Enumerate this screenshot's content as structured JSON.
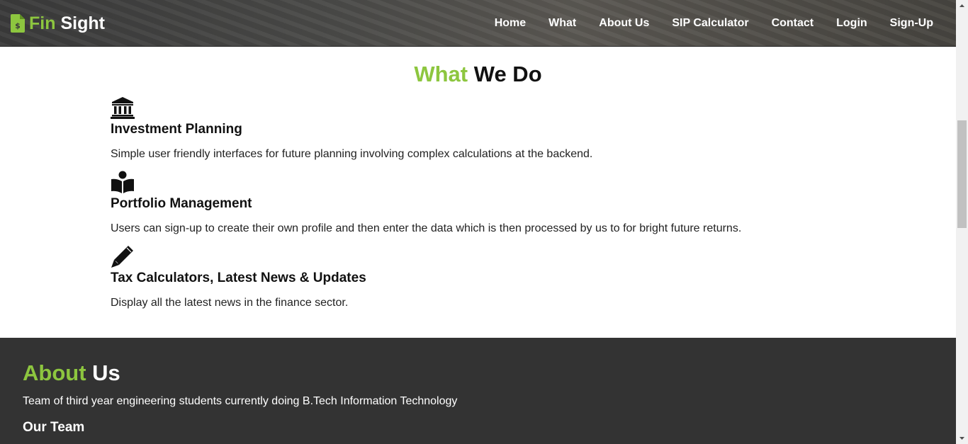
{
  "brand": {
    "part1": "Fin",
    "part2": "Sight",
    "icon": "document-dollar-icon"
  },
  "nav": {
    "items": [
      {
        "label": "Home"
      },
      {
        "label": "What"
      },
      {
        "label": "About Us"
      },
      {
        "label": "SIP Calculator"
      },
      {
        "label": "Contact"
      },
      {
        "label": "Login"
      },
      {
        "label": "Sign-Up"
      }
    ]
  },
  "what_section": {
    "heading_highlight": "What",
    "heading_rest": "We Do",
    "features": [
      {
        "icon": "bank-icon",
        "title": "Investment Planning",
        "description": "Simple user friendly interfaces for future planning involving complex calculations at the backend."
      },
      {
        "icon": "reader-icon",
        "title": "Portfolio Management",
        "description": "Users can sign-up to create their own profile and then enter the data which is then processed by us to for bright future returns."
      },
      {
        "icon": "pencil-icon",
        "title": "Tax Calculators, Latest News & Updates",
        "description": "Display all the latest news in the finance sector."
      }
    ]
  },
  "about_section": {
    "heading_highlight": "About",
    "heading_rest": "Us",
    "text": "Team of third year engineering students currently doing B.Tech Information Technology",
    "team_heading": "Our Team"
  },
  "colors": {
    "accent": "#8dc63f",
    "dark_section": "#333333"
  }
}
